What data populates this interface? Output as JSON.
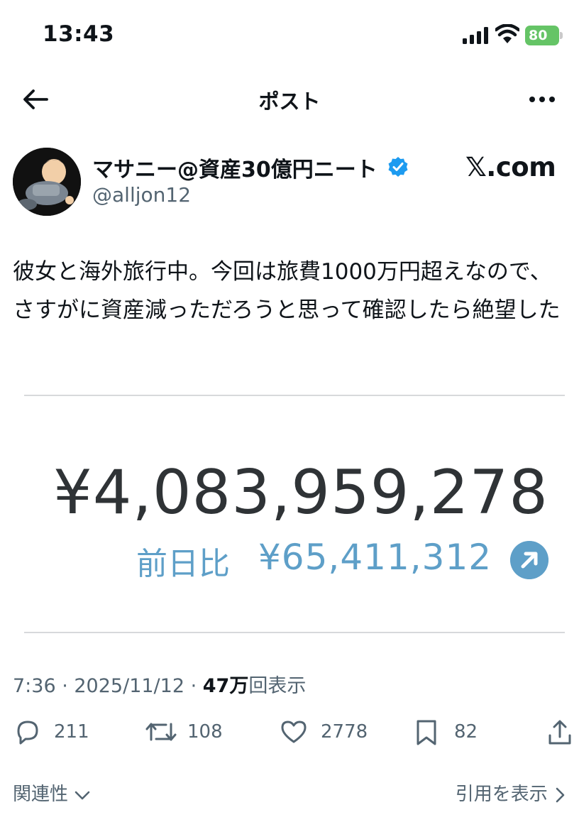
{
  "status_bar": {
    "time": "13:43",
    "battery": "80",
    "battery_color": "#65c466",
    "icons": [
      "signal-bars-icon",
      "wifi-icon",
      "battery-icon"
    ]
  },
  "nav": {
    "title": "ポスト",
    "back_icon": "arrow-left-icon",
    "more_icon": "more-horizontal-icon"
  },
  "author": {
    "name": "マサニー@資産30億円ニート",
    "handle": "@alljon12",
    "verified": true,
    "verified_color": "#1d9bf0"
  },
  "watermark": "𝕏.com",
  "post": {
    "text": "彼女と海外旅行中。今回は旅費1000万円超えなので、さすがに資産減っただろうと思って確認したら絶望した"
  },
  "media": {
    "amount": "¥4,083,959,278",
    "change_label": "前日比",
    "change_value": "¥65,411,312",
    "accent_color": "#5e9fc8",
    "change_icon": "arrow-up-right-icon"
  },
  "meta": {
    "time_date": "7:36 · 2025/11/12 · ",
    "views_count": "47万",
    "views_label": "回表示"
  },
  "actions": {
    "replies": "211",
    "reposts": "108",
    "likes": "2778",
    "bookmarks": "82"
  },
  "footer": {
    "related_label": "関連性",
    "quotes_label": "引用を表示"
  }
}
